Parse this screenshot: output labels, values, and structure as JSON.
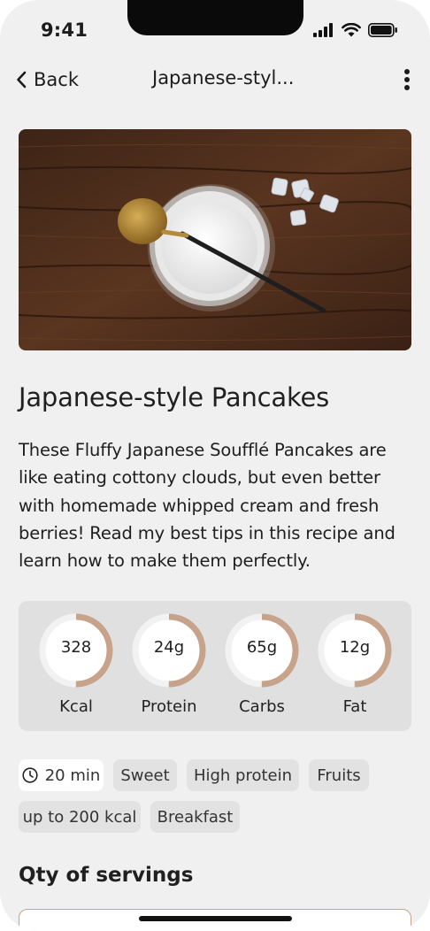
{
  "status_bar": {
    "time": "9:41"
  },
  "nav": {
    "back_label": "Back",
    "title": "Japanese-styl..."
  },
  "recipe": {
    "title": "Japanese-style Pancakes",
    "description": "These Fluffy Japanese Soufflé Pancakes are like eating cottony clouds, but even better with homemade whipped cream and fresh berries! Read my best tips in this recipe and learn how to make them perfectly."
  },
  "nutrition": [
    {
      "value": "328",
      "label": "Kcal",
      "progress": 0.5
    },
    {
      "value": "24g",
      "label": "Protein",
      "progress": 0.5
    },
    {
      "value": "65g",
      "label": "Carbs",
      "progress": 0.5
    },
    {
      "value": "12g",
      "label": "Fat",
      "progress": 0.5
    }
  ],
  "tags": {
    "time": "20 min",
    "items": [
      "Sweet",
      "High protein",
      "Fruits",
      "up to 200 kcal",
      "Breakfast"
    ]
  },
  "servings": {
    "title": "Qty of servings"
  },
  "colors": {
    "accent": "#c6a38a",
    "ring_track": "#f2f2f2",
    "background": "#f0f0f0",
    "card": "#e0e0e0",
    "tag": "#e2e2e2"
  }
}
